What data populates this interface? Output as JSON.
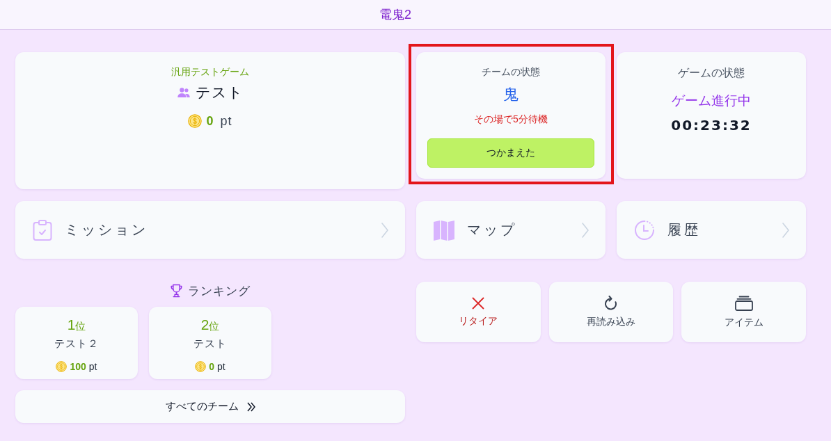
{
  "header": {
    "title": "電鬼2"
  },
  "team_card": {
    "game_name": "汎用テストゲーム",
    "team_name": "テスト",
    "points": "0",
    "points_unit": "pt"
  },
  "team_status": {
    "heading": "チームの状態",
    "role": "鬼",
    "instruction": "その場で5分待機",
    "action_button": "つかまえた",
    "highlighted": true
  },
  "game_status": {
    "heading": "ゲームの状態",
    "state": "ゲーム進行中",
    "elapsed": "00:23:32"
  },
  "nav_links": [
    {
      "kind": "mission",
      "label": "ミッション"
    },
    {
      "kind": "map",
      "label": "マップ"
    },
    {
      "kind": "history",
      "label": "履歴"
    }
  ],
  "ranking": {
    "title": "ランキング",
    "entries": [
      {
        "rank": "1",
        "rank_suffix": "位",
        "team": "テスト２",
        "points": "100",
        "unit": "pt"
      },
      {
        "rank": "2",
        "rank_suffix": "位",
        "team": "テスト",
        "points": "0",
        "unit": "pt"
      }
    ],
    "all_teams_button": "すべてのチーム"
  },
  "actions": [
    {
      "kind": "retire",
      "label": "リタイア"
    },
    {
      "kind": "reload",
      "label": "再読み込み"
    },
    {
      "kind": "items",
      "label": "アイテム"
    }
  ]
}
